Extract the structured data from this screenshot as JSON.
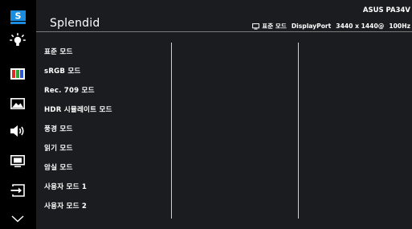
{
  "app": {
    "title": "Splendid",
    "brand": "ASUS PA34V"
  },
  "status": {
    "mode": "표준 모드",
    "input": "DisplayPort",
    "resolution": "3440 x 1440@",
    "refresh": "100Hz"
  },
  "sidebar": {
    "items": [
      {
        "icon": "splendid-s-icon",
        "active": true
      },
      {
        "icon": "brightness-icon"
      },
      {
        "icon": "color-bars-icon"
      },
      {
        "icon": "image-icon"
      },
      {
        "icon": "sound-icon"
      },
      {
        "icon": "pip-icon"
      },
      {
        "icon": "input-select-icon"
      },
      {
        "icon": "chevron-down-icon"
      }
    ]
  },
  "menu": {
    "items": [
      "표준 모드",
      "sRGB 모드",
      "Rec. 709 모드",
      "HDR 시뮬레이트 모드",
      "풍경 모드",
      "읽기 모드",
      "암실 모드",
      "사용자 모드 1",
      "사용자 모드 2"
    ]
  },
  "colors": {
    "accent": "#1b8de0",
    "panel": "#1b1c1f",
    "sidebar": "#000000",
    "text": "#ffffff"
  }
}
